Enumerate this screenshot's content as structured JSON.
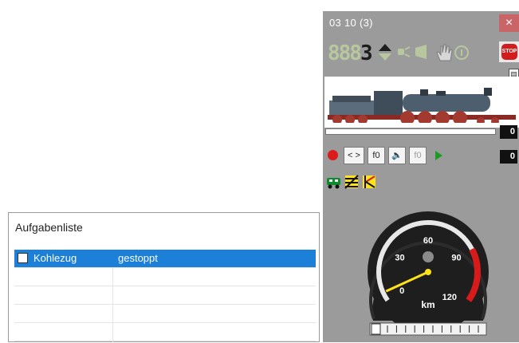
{
  "tasklist": {
    "title": "Aufgabenliste",
    "rows": [
      {
        "name": "Kohlezug",
        "status": "gestoppt",
        "checked": false,
        "selected": true
      },
      {
        "name": "",
        "status": "",
        "checked": false,
        "selected": false
      },
      {
        "name": "",
        "status": "",
        "checked": false,
        "selected": false
      },
      {
        "name": "",
        "status": "",
        "checked": false,
        "selected": false
      },
      {
        "name": "",
        "status": "",
        "checked": false,
        "selected": false
      }
    ]
  },
  "panel": {
    "title": "03 10   (3)",
    "close_label": "×",
    "address_dim": "888",
    "address_lit": "3",
    "stop_label": "STOP",
    "value_top": "0",
    "value_fn": "0",
    "fn_labels": [
      "< >",
      "f0",
      "f0"
    ],
    "gauge": {
      "ticks": [
        "0",
        "30",
        "60",
        "90",
        "120"
      ],
      "unit": "km",
      "needle_value": 5,
      "max": 120,
      "redline_from": 90,
      "slider_value": 0
    },
    "colors": {
      "panel_bg": "#9b9b9b",
      "close_bg": "#c96467",
      "selection": "#1c7fd8",
      "stop_red": "#d31d1d",
      "needle": "#ffe316"
    },
    "icons": [
      "arrow-up-down-icon",
      "light-icon",
      "horn-icon",
      "hand-icon",
      "info-icon",
      "train-car-icon",
      "signal-icon",
      "crossing-icon",
      "record-icon",
      "play-icon",
      "speaker-icon"
    ]
  }
}
